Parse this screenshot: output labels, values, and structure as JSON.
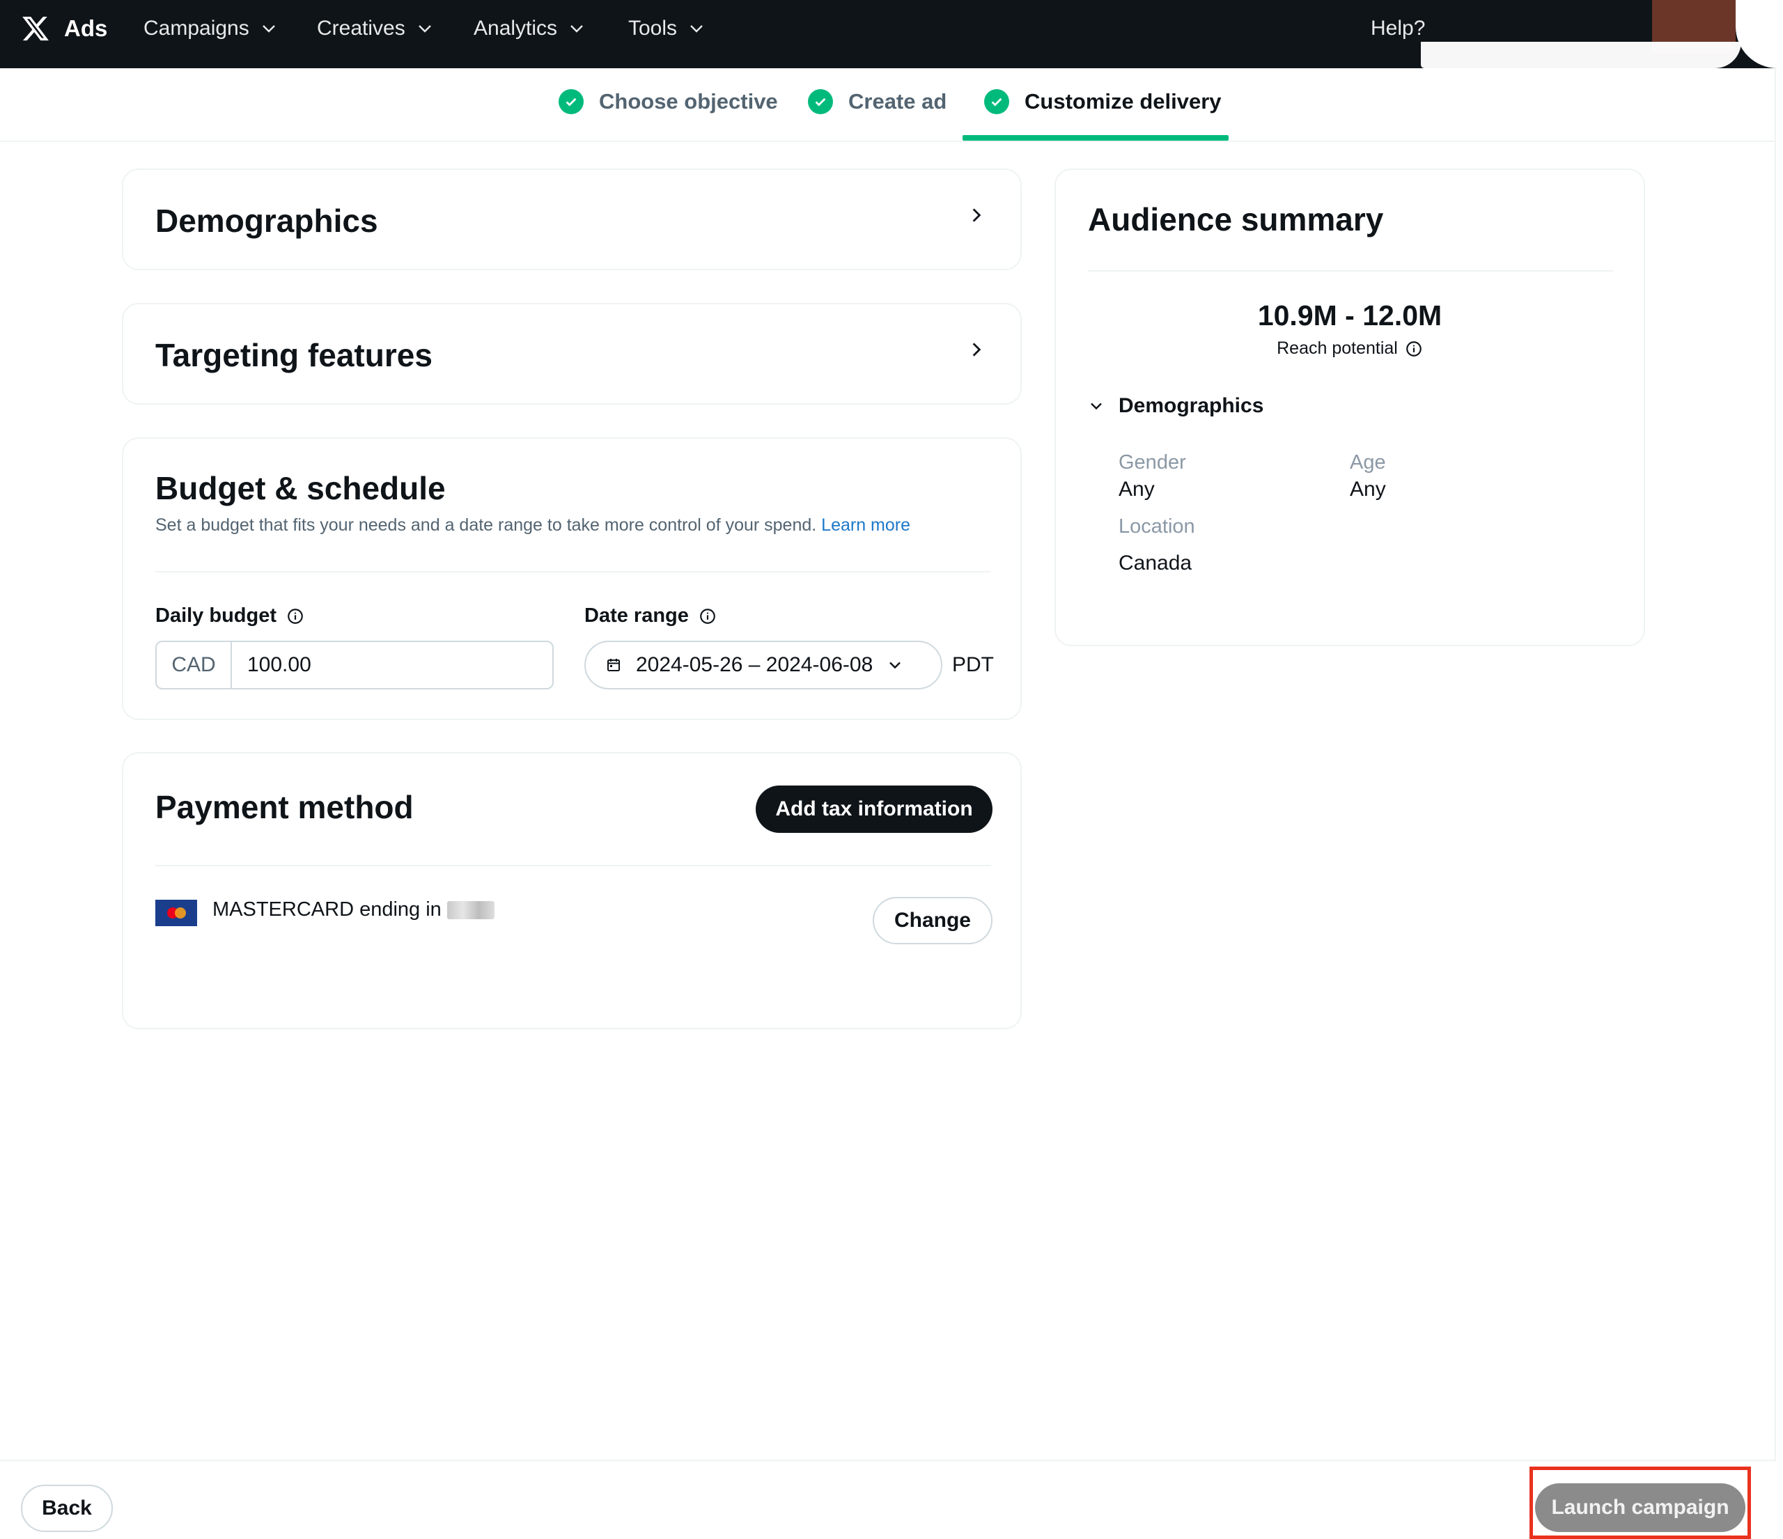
{
  "nav": {
    "brand": "Ads",
    "items": [
      {
        "label": "Campaigns"
      },
      {
        "label": "Creatives"
      },
      {
        "label": "Analytics"
      },
      {
        "label": "Tools"
      }
    ],
    "help": "Help?"
  },
  "steps": [
    {
      "label": "Choose objective",
      "done": true
    },
    {
      "label": "Create ad",
      "done": true
    },
    {
      "label": "Customize delivery",
      "done": true,
      "active": true
    }
  ],
  "demographics_card": {
    "title": "Demographics"
  },
  "targeting_card": {
    "title": "Targeting features"
  },
  "budget": {
    "title": "Budget & schedule",
    "description": "Set a budget that fits your needs and a date range to take more control of your spend.",
    "learn_more": "Learn more",
    "daily_budget_label": "Daily budget",
    "currency": "CAD",
    "amount": "100.00",
    "date_range_label": "Date range",
    "date_range": "2024-05-26 – 2024-06-08",
    "timezone": "PDT"
  },
  "payment": {
    "title": "Payment method",
    "add_tax": "Add tax information",
    "card_text": "MASTERCARD ending in",
    "change": "Change"
  },
  "audience": {
    "title": "Audience summary",
    "reach": "10.9M - 12.0M",
    "reach_label": "Reach potential",
    "demographics_label": "Demographics",
    "gender_label": "Gender",
    "gender": "Any",
    "age_label": "Age",
    "age": "Any",
    "location_label": "Location",
    "location": "Canada"
  },
  "footer": {
    "back": "Back",
    "launch": "Launch campaign"
  },
  "colors": {
    "nav_bg": "#0f1419",
    "accent_green": "#00ba7c",
    "link_blue": "#1d78c8",
    "launch_disabled": "#8b8b8b",
    "highlight_red": "#e8321e"
  }
}
